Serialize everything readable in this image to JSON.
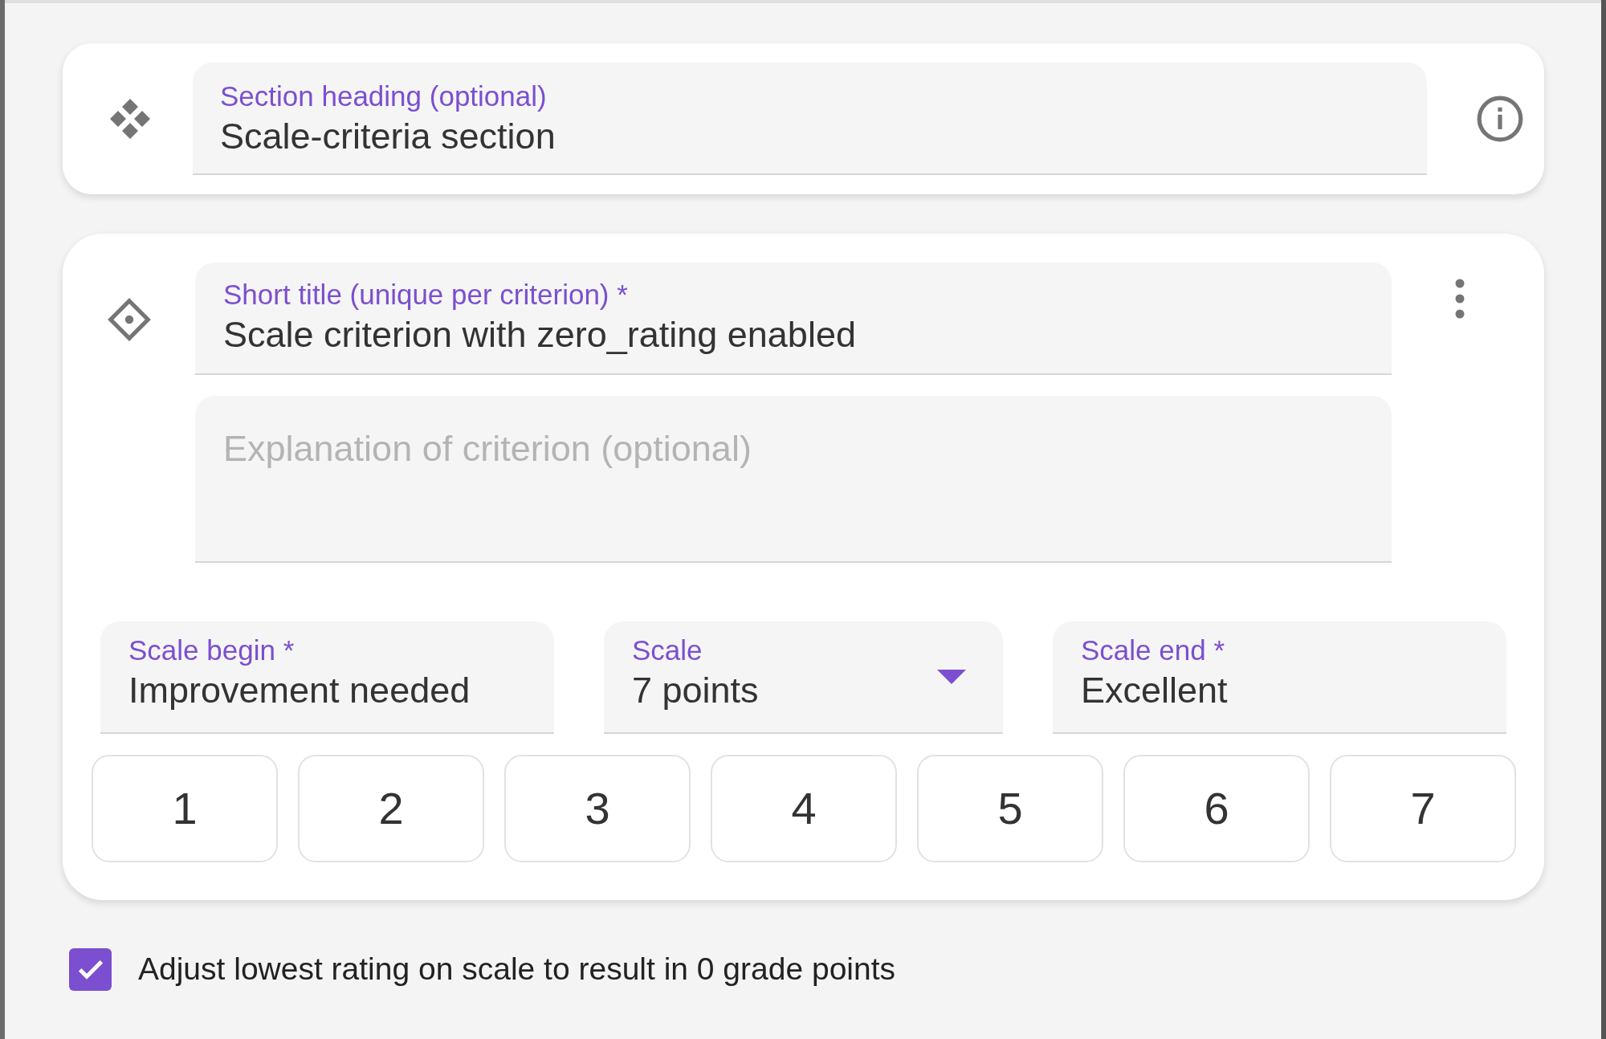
{
  "section": {
    "heading": {
      "label": "Section heading (optional)",
      "value": "Scale-criteria section"
    }
  },
  "criterion": {
    "title": {
      "label": "Short title (unique per criterion) *",
      "value": "Scale criterion with zero_rating enabled"
    },
    "explanation": {
      "placeholder": "Explanation of criterion (optional)"
    },
    "scale_begin": {
      "label": "Scale begin *",
      "value": "Improvement needed"
    },
    "scale": {
      "label": "Scale",
      "value": "7 points"
    },
    "scale_end": {
      "label": "Scale end *",
      "value": "Excellent"
    },
    "points": [
      "1",
      "2",
      "3",
      "4",
      "5",
      "6",
      "7"
    ]
  },
  "zero_rating": {
    "label": "Adjust lowest rating on scale to result in 0 grade points",
    "checked": true
  }
}
